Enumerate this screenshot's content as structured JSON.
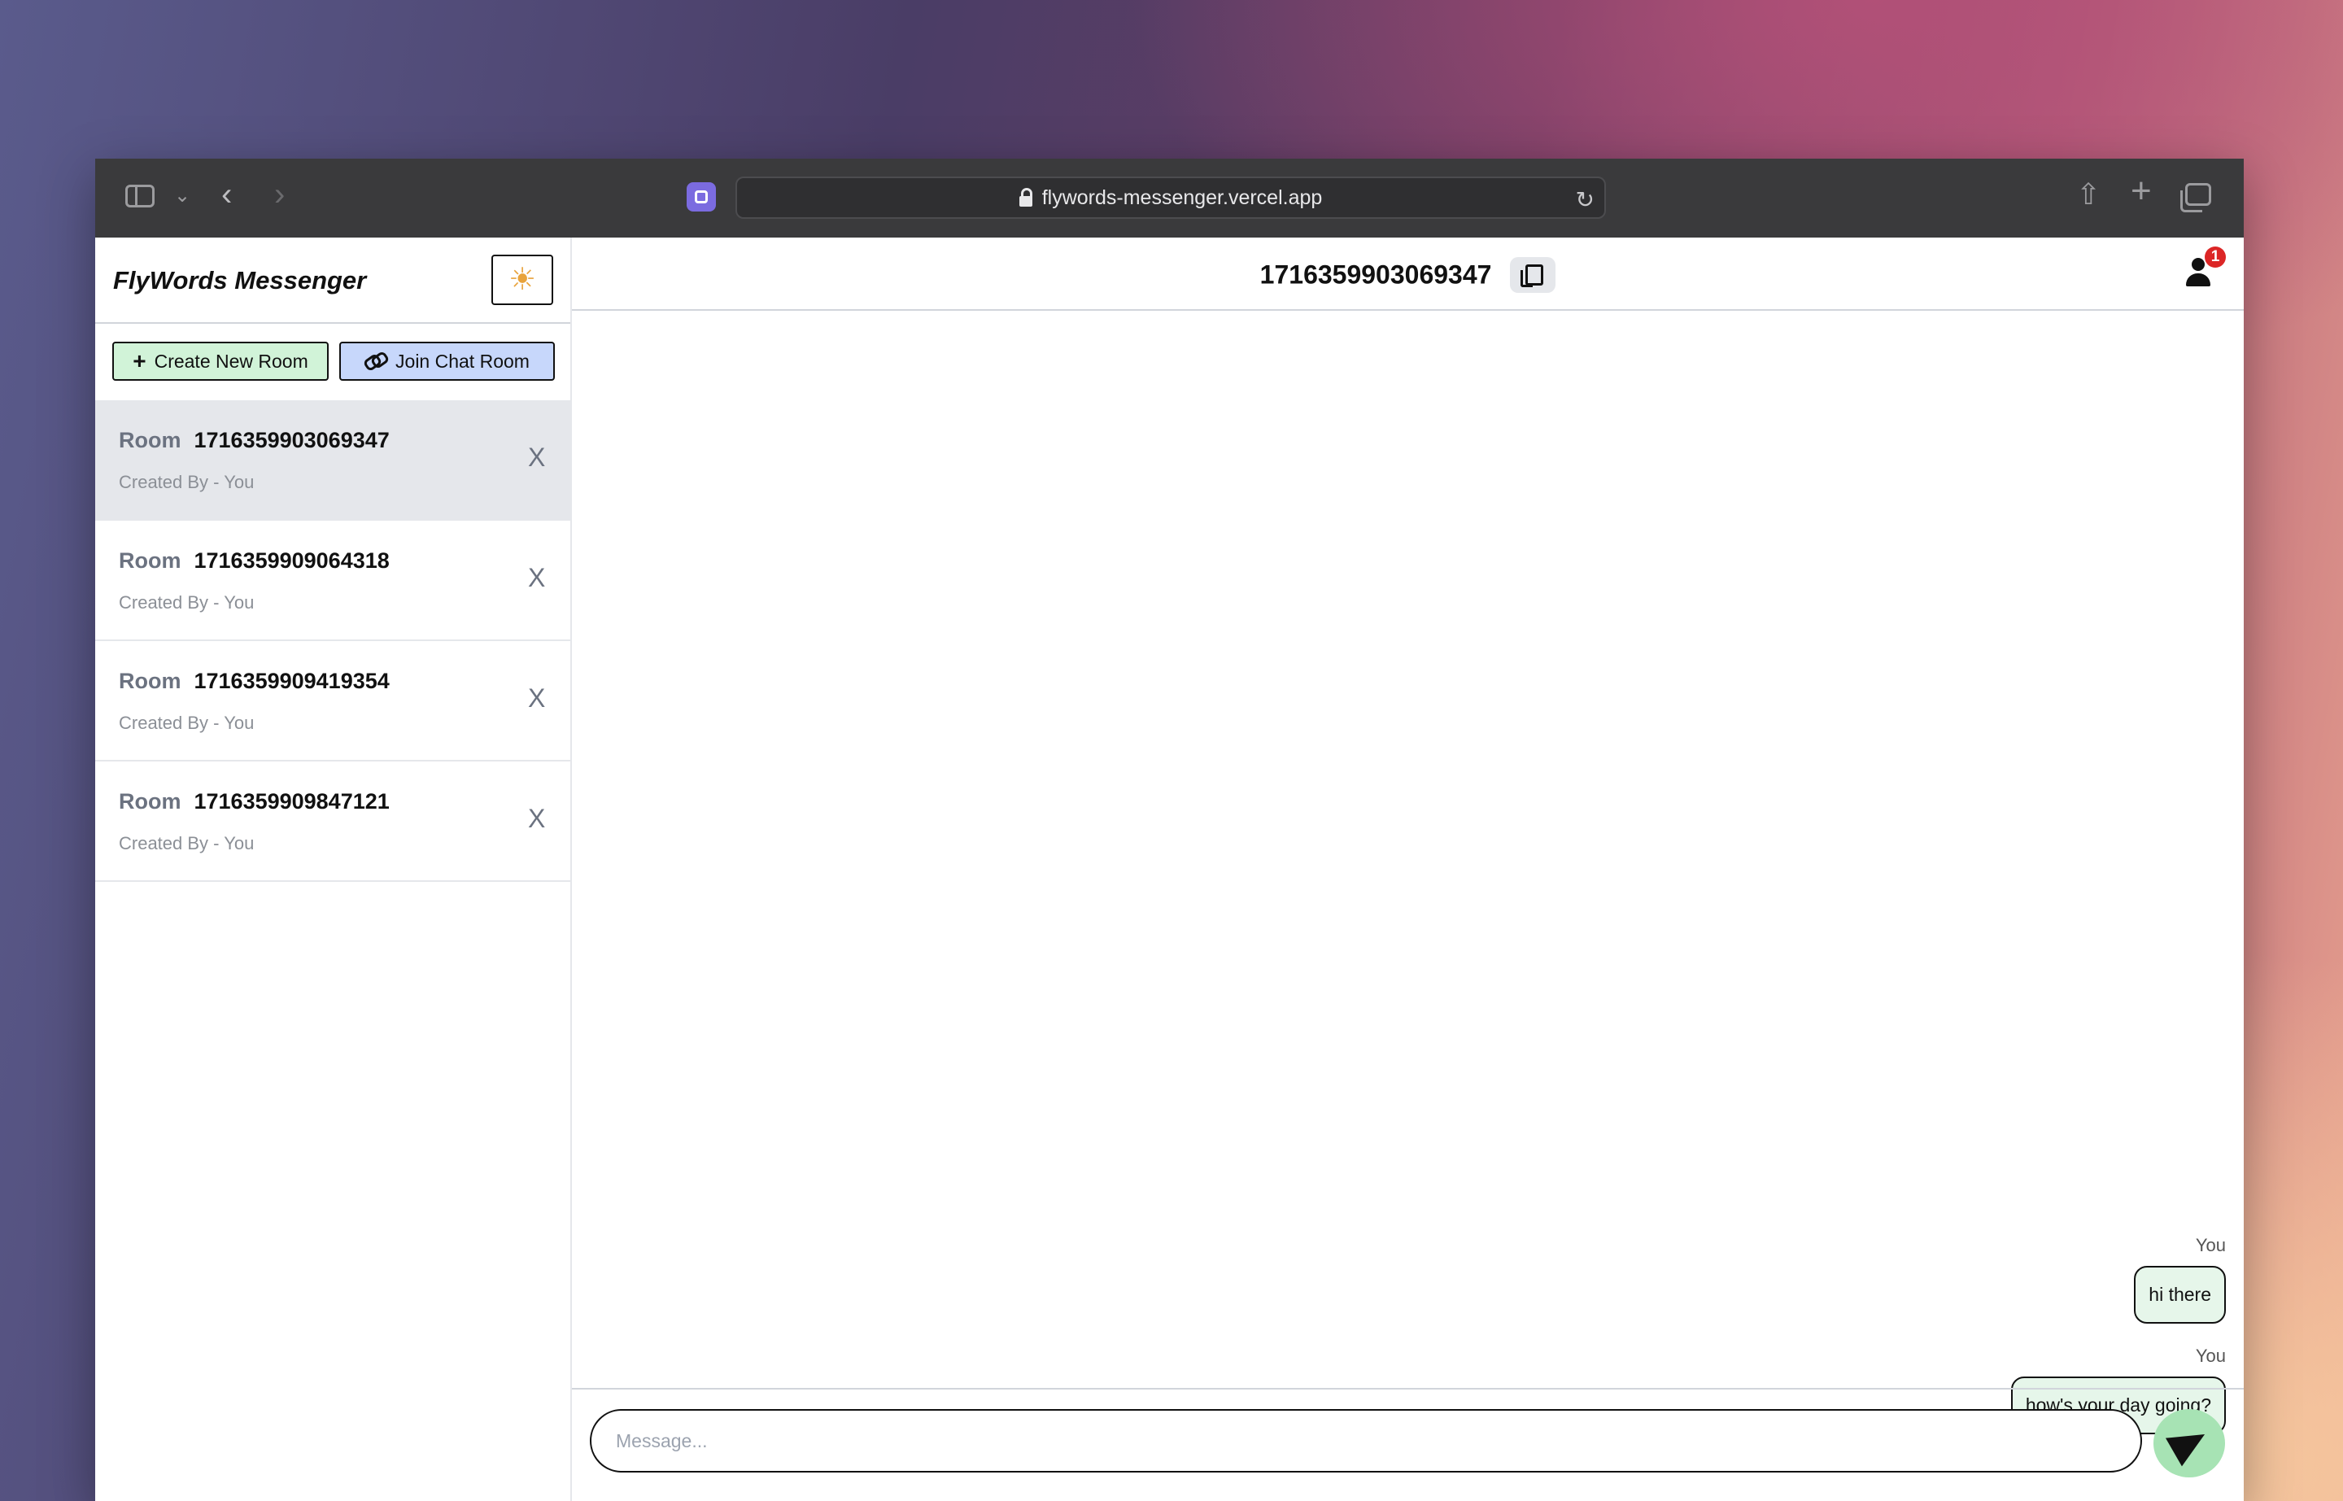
{
  "browser": {
    "url": "flywords-messenger.vercel.app"
  },
  "app": {
    "brand": "FlyWords Messenger",
    "create_button": "Create New Room",
    "join_button": "Join Chat Room",
    "create_icon": "+"
  },
  "rooms": [
    {
      "prefix": "Room",
      "id": "1716359903069347",
      "subtitle": "Created By - You",
      "close": "X",
      "active": true
    },
    {
      "prefix": "Room",
      "id": "1716359909064318",
      "subtitle": "Created By - You",
      "close": "X",
      "active": false
    },
    {
      "prefix": "Room",
      "id": "1716359909419354",
      "subtitle": "Created By - You",
      "close": "X",
      "active": false
    },
    {
      "prefix": "Room",
      "id": "1716359909847121",
      "subtitle": "Created By - You",
      "close": "X",
      "active": false
    }
  ],
  "chat": {
    "room_title": "1716359903069347",
    "notification_count": "1",
    "messages": [
      {
        "sender": "You",
        "text": "hi there"
      },
      {
        "sender": "You",
        "text": "how's your day going?"
      }
    ],
    "input_placeholder": "Message...",
    "input_value": ""
  },
  "icons": {
    "sun": "sun-icon",
    "copy": "copy-icon",
    "user": "user-icon",
    "send": "send-icon",
    "link": "link-icon"
  },
  "colors": {
    "create_button_bg": "#d1f3d8",
    "join_button_bg": "#c7d7fb",
    "active_room_bg": "#e5e7eb",
    "bubble_bg": "#e6f6ea",
    "send_button_bg": "#a7e3b4",
    "badge": "#dc2626"
  }
}
